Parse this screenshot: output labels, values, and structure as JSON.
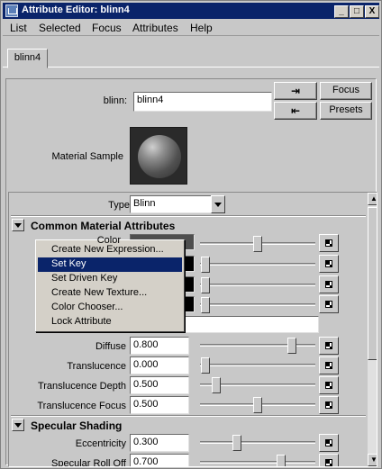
{
  "window": {
    "title": "Attribute Editor: blinn4",
    "controls": {
      "minimize": "_",
      "maximize": "□",
      "close": "X"
    }
  },
  "menubar": [
    "List",
    "Selected",
    "Focus",
    "Attributes",
    "Help"
  ],
  "tab": {
    "label": "blinn4"
  },
  "node": {
    "label": "blinn:",
    "value": "blinn4"
  },
  "buttons": {
    "focus": "Focus",
    "presets": "Presets",
    "select_icon": "input-connection-icon",
    "output_icon": "output-connection-icon"
  },
  "material_sample": {
    "label": "Material Sample"
  },
  "type": {
    "label": "Type",
    "value": "Blinn"
  },
  "sections": {
    "common": "Common Material Attributes",
    "specular": "Specular Shading"
  },
  "context_menu": {
    "items": [
      "Create New Expression...",
      "Set Key",
      "Set Driven Key",
      "Create New Texture...",
      "Color Chooser...",
      "Lock Attribute"
    ],
    "highlighted_index": 1
  },
  "common_rows": [
    {
      "label": "Color",
      "value": "",
      "slider": 0.5
    },
    {
      "label": "",
      "value": "",
      "slider": 0.05
    },
    {
      "label": "",
      "value": "",
      "slider": 0.05
    },
    {
      "label": "",
      "value": "",
      "slider": 0.05
    },
    {
      "label": "Diffuse",
      "value": "0.800",
      "slider": 0.8
    },
    {
      "label": "Translucence",
      "value": "0.000",
      "slider": 0.05
    },
    {
      "label": "Translucence Depth",
      "value": "0.500",
      "slider": 0.14
    },
    {
      "label": "Translucence Focus",
      "value": "0.500",
      "slider": 0.5
    }
  ],
  "specular_rows": [
    {
      "label": "Eccentricity",
      "value": "0.300",
      "slider": 0.32
    },
    {
      "label": "Specular Roll Off",
      "value": "0.700",
      "slider": 0.7
    }
  ]
}
